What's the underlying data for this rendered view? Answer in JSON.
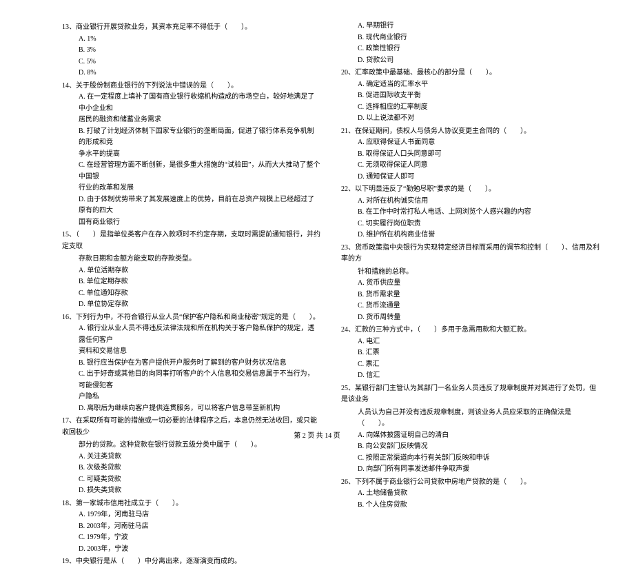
{
  "footer": "第 2 页 共 14 页",
  "left": {
    "q13": {
      "stem": "13、商业银行开展贷款业务，其资本充足率不得低于（　　）。",
      "a": "A. 1%",
      "b": "B. 3%",
      "c": "C. 5%",
      "d": "D. 8%"
    },
    "q14": {
      "stem": "14、关于股份制商业银行的下列说法中错误的是（　　）。",
      "a1": "A. 在一定程度上填补了国有商业银行收缩机构造成的市场空白，较好地满足了中小企业和",
      "a2": "居民的融资和储蓄业务需求",
      "b1": "B. 打破了计划经济体制下国家专业银行的垄断局面，促进了银行体系竞争机制的形成和竞",
      "b2": "争水平的提高",
      "c1": "C. 在经营管理方面不断创新，是很多重大措施的“试验田”，从而大大推动了整个中国银",
      "c2": "行业的改革和发展",
      "d1": "D. 由于体制优势带来了其发展速度上的优势，目前在总资产规模上已经超过了原有的四大",
      "d2": "国有商业银行"
    },
    "q15": {
      "stem1": "15、（　　）是指单位类客户在存入款项时不约定存期，支取时需提前通知银行，并约定支取",
      "stem2": "存款日期和金额方能支取的存款类型。",
      "a": "A. 单位活期存款",
      "b": "B. 单位定期存款",
      "c": "C. 单位通知存款",
      "d": "D. 单位协定存款"
    },
    "q16": {
      "stem": "16、下列行为中，不符合银行从业人员“保护客户隐私和商业秘密”规定的是（　　）。",
      "a1": "A. 银行业从业人员不得违反法律法规和所在机构关于客户隐私保护的规定，透露任何客户",
      "a2": "资料和交易信息",
      "b": "B. 银行应当保护在为客户提供开户服务时了解到的客户财务状况信息",
      "c1": "C. 出于好奇或其他目的向同事打听客户的个人信息和交易信息属于不当行为，可能侵犯客",
      "c2": "户隐私",
      "d": "D. 离职后为继续向客户提供连贯服务，可以将客户信息带至新机构"
    },
    "q17": {
      "stem1": "17、在采取所有可能的措施或一切必要的法律程序之后，本息仍然无法收回，或只能收回极少",
      "stem2": "部分的贷款。这种贷款在银行贷款五级分类中属于（　　）。",
      "a": "A. 关注类贷款",
      "b": "B. 次级类贷款",
      "c": "C. 可疑类贷款",
      "d": "D. 损失类贷款"
    },
    "q18": {
      "stem": "18、第一家城市信用社成立于（　　）。",
      "a": "A. 1979年，河南驻马店",
      "b": "B. 2003年，河南驻马店",
      "c": "C. 1979年，宁波",
      "d": "D. 2003年，宁波"
    },
    "q19": {
      "stem": "19、中央银行是从（　　）中分离出来，逐渐演变而成的。"
    }
  },
  "right": {
    "q19opts": {
      "a": "A. 早期银行",
      "b": "B. 现代商业银行",
      "c": "C. 政策性银行",
      "d": "D. 贷款公司"
    },
    "q20": {
      "stem": "20、汇率政策中最基础、最核心的部分是（　　）。",
      "a": "A. 确定适当的汇率水平",
      "b": "B. 促进国际收支平衡",
      "c": "C. 选择相应的汇率制度",
      "d": "D. 以上说法都不对"
    },
    "q21": {
      "stem": "21、在保证期间，债权人与债务人协议变更主合同的（　　）。",
      "a": "A. 应取得保证人书面同意",
      "b": "B. 取得保证人口头同意即可",
      "c": "C. 无须取得保证人同意",
      "d": "D. 通知保证人即可"
    },
    "q22": {
      "stem": "22、以下明显违反了“勤勉尽职”要求的是（　　）。",
      "a": "A. 对所在机构诚实信用",
      "b": "B. 在工作中时常打私人电话、上网浏览个人感兴趣的内容",
      "c": "C. 切实履行岗位职责",
      "d": "D. 维护所在机构商业信誉"
    },
    "q23": {
      "stem1": "23、货币政策指中央银行为实现特定经济目标而采用的调节和控制（　　）、信用及利率的方",
      "stem2": "针和措施的总称。",
      "a": "A. 货币供应量",
      "b": "B. 货币需求量",
      "c": "C. 货币流通量",
      "d": "D. 货币周转量"
    },
    "q24": {
      "stem": "24、汇款的三种方式中，（　　）多用于急需用款和大额汇款。",
      "a": "A. 电汇",
      "b": "B. 汇票",
      "c": "C. 票汇",
      "d": "D. 信汇"
    },
    "q25": {
      "stem1": "25、某银行部门主管认为其部门一名业务人员违反了规章制度并对其进行了处罚，但是该业务",
      "stem2": "人员认为自己并没有违反规章制度，则该业务人员应采取的正确做法是（　　）。",
      "a": "A. 向媒体披露证明自己的清白",
      "b": "B. 向公安部门反映情况",
      "c": "C. 按照正常渠道向本行有关部门反映和申诉",
      "d": "D. 向部门所有同事发送邮件争取声援"
    },
    "q26": {
      "stem": "26、下列不属于商业银行公司贷款中房地产贷款的是（　　）。",
      "a": "A. 土地储备贷款",
      "b": "B. 个人住房贷款"
    }
  }
}
